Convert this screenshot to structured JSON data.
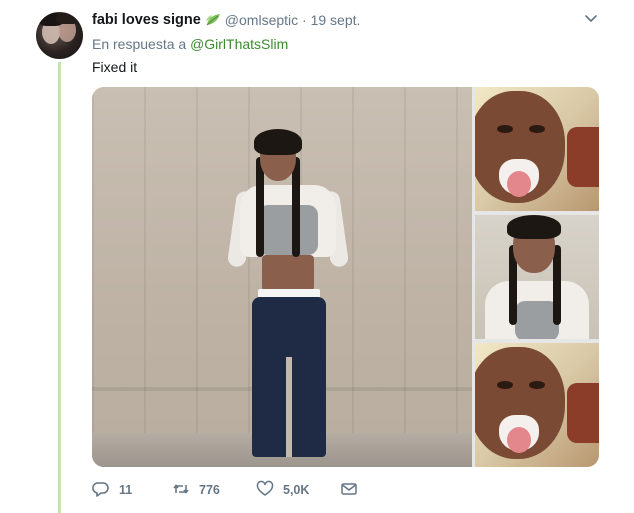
{
  "tweet": {
    "display_name": "fabi loves signe",
    "handle_and_date": "@omlseptic · 19 sept.",
    "reply_prefix": "En respuesta a",
    "reply_mention": "@GirlThatsSlim",
    "text": "Fixed it"
  },
  "actions": {
    "reply_count": "11",
    "retweet_count": "776",
    "like_count": "5,0K"
  },
  "colors": {
    "thread_line": "#c4e3b8",
    "mention": "#3b8a2e",
    "muted": "#657786"
  },
  "icons": {
    "name_badge": "leaf-icon",
    "menu": "chevron-down-icon",
    "reply": "reply-icon",
    "retweet": "retweet-icon",
    "like": "heart-icon",
    "dm": "envelope-icon"
  }
}
